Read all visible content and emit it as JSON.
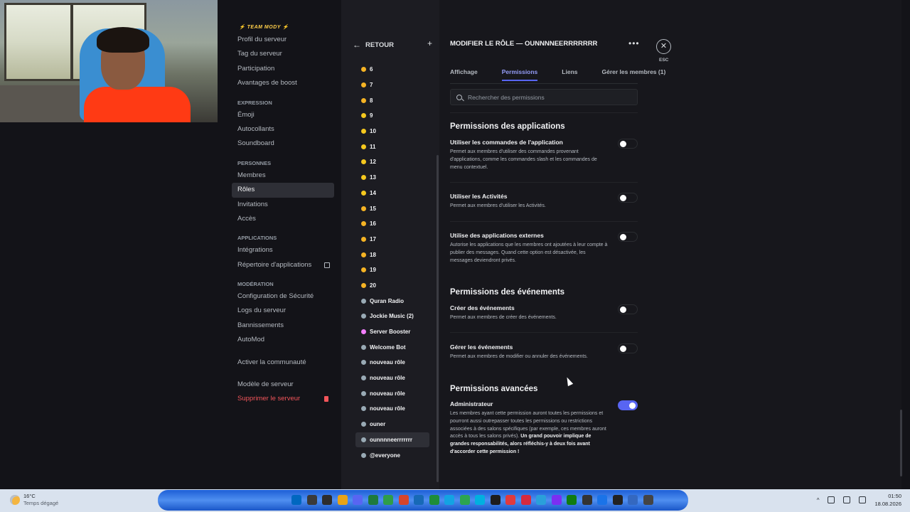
{
  "window": {
    "minimize": "‒",
    "maximize": "▢",
    "close": "✕"
  },
  "sidebar": {
    "team_title": "⚡ TEAM MODY ⚡",
    "groups": [
      {
        "header": "",
        "items": [
          "Profil du serveur",
          "Tag du serveur",
          "Participation",
          "Avantages de boost"
        ]
      },
      {
        "header": "EXPRESSION",
        "items": [
          "Émoji",
          "Autocollants",
          "Soundboard"
        ]
      },
      {
        "header": "PERSONNES",
        "items": [
          "Membres",
          "Rôles",
          "Invitations",
          "Accès"
        ]
      },
      {
        "header": "APPLICATIONS",
        "items": [
          "Intégrations",
          "Répertoire d'applications"
        ]
      },
      {
        "header": "MODÉRATION",
        "items": [
          "Configuration de Sécurité",
          "Logs du serveur",
          "Bannissements",
          "AutoMod"
        ]
      }
    ],
    "community": "Activer la communauté",
    "template": "Modèle de serveur",
    "delete": "Supprimer le serveur",
    "active_item": "Rôles"
  },
  "roles": {
    "back_label": "RETOUR",
    "add": "+",
    "items": [
      {
        "name": "6",
        "color": "#f5b324"
      },
      {
        "name": "7",
        "color": "#f5b324"
      },
      {
        "name": "8",
        "color": "#f5b324"
      },
      {
        "name": "9",
        "color": "#f5c81e"
      },
      {
        "name": "10",
        "color": "#f5c81e"
      },
      {
        "name": "11",
        "color": "#f5c81e"
      },
      {
        "name": "12",
        "color": "#f5c81e"
      },
      {
        "name": "13",
        "color": "#f5c81e"
      },
      {
        "name": "14",
        "color": "#f5c81e"
      },
      {
        "name": "15",
        "color": "#f5b324"
      },
      {
        "name": "16",
        "color": "#f5b324"
      },
      {
        "name": "17",
        "color": "#f5b324"
      },
      {
        "name": "18",
        "color": "#f5b324"
      },
      {
        "name": "19",
        "color": "#f5b324"
      },
      {
        "name": "20",
        "color": "#f5b324"
      },
      {
        "name": "Quran Radio",
        "color": "#99aab5"
      },
      {
        "name": "Jockie Music (2)",
        "color": "#99aab5"
      },
      {
        "name": "Server Booster",
        "color": "#f47fff"
      },
      {
        "name": "Welcome Bot",
        "color": "#99aab5"
      },
      {
        "name": "nouveau rôle",
        "color": "#99aab5"
      },
      {
        "name": "nouveau rôle",
        "color": "#99aab5"
      },
      {
        "name": "nouveau rôle",
        "color": "#99aab5"
      },
      {
        "name": "nouveau rôle",
        "color": "#99aab5"
      },
      {
        "name": "ouner",
        "color": "#99aab5"
      },
      {
        "name": "ounnnneerrrrrrr",
        "color": "#99aab5",
        "selected": true
      },
      {
        "name": "@everyone",
        "color": "#99aab5"
      }
    ]
  },
  "edit": {
    "title": "MODIFIER LE RÔLE — OUNNNNEERRRRRRR",
    "more": "•••",
    "close": "✕",
    "esc": "ESC",
    "tabs": [
      "Affichage",
      "Permissions",
      "Liens",
      "Gérer les membres (1)"
    ],
    "active_tab": "Permissions",
    "search_placeholder": "Rechercher des permissions"
  },
  "sections": {
    "applications": {
      "title": "Permissions des applications",
      "perms": [
        {
          "name": "Utiliser les commandes de l'application",
          "desc": "Permet aux membres d'utiliser des commandes provenant d'applications, comme les commandes slash et les commandes de menu contextuel.",
          "on": false
        },
        {
          "name": "Utiliser les Activités",
          "desc": "Permet aux membres d'utiliser les Activités.",
          "on": false
        },
        {
          "name": "Utilise des applications externes",
          "desc": "Autorise les applications que les membres ont ajoutées à leur compte à publier des messages. Quand cette option est désactivée, les messages deviendront privés.",
          "on": false
        }
      ]
    },
    "events": {
      "title": "Permissions des événements",
      "perms": [
        {
          "name": "Créer des événements",
          "desc": "Permet aux membres de créer des événements.",
          "on": false
        },
        {
          "name": "Gérer les événements",
          "desc": "Permet aux membres de modifier ou annuler des événements.",
          "on": false
        }
      ]
    },
    "advanced": {
      "title": "Permissions avancées",
      "perms": [
        {
          "name": "Administrateur",
          "desc": "Les membres ayant cette permission auront toutes les permissions et pourront aussi outrepasser toutes les permissions ou restrictions associées à des salons spécifiques (par exemple, ces membres auront accès à tous les salons privés).",
          "desc_bold": "Un grand pouvoir implique de grandes responsabilités, alors réfléchis-y à deux fois avant d'accorder cette permission !",
          "on": true
        }
      ]
    }
  },
  "taskbar": {
    "temp": "16°C",
    "weather": "Temps dégagé",
    "time": "01:50",
    "date": "18.08.2026",
    "tray_arrow": "^",
    "icon_colors": [
      "#0067c0",
      "#3a3a3a",
      "#2d2d2d",
      "#e8a317",
      "#5865f2",
      "#1e7a3c",
      "#2e9d49",
      "#d6452b",
      "#1769b7",
      "#1e8d3a",
      "#13a3e3",
      "#2ca54f",
      "#00b0e0",
      "#1d1d1d",
      "#e03a3e",
      "#d52a40",
      "#2aa0da",
      "#7b2ff2",
      "#107c10",
      "#333333",
      "#1a73e8",
      "#222222",
      "#3468c0",
      "#444444"
    ]
  },
  "colors": {
    "accent": "#5865f2",
    "danger": "#f2555a",
    "team": "#ffcf4a"
  }
}
